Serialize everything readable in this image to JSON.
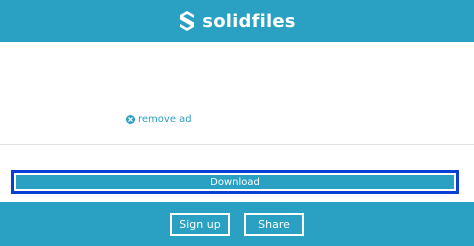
{
  "header": {
    "brand_name": "solidfiles",
    "logo_icon": "solidfiles-logo-icon"
  },
  "content": {
    "remove_ad_label": "remove ad",
    "remove_ad_icon": "close-circle-icon"
  },
  "download": {
    "label": "Download"
  },
  "footer": {
    "signup_label": "Sign up",
    "share_label": "Share"
  },
  "colors": {
    "brand": "#2aa0c2",
    "highlight": "#0a3fd6",
    "background": "#ffffff"
  }
}
